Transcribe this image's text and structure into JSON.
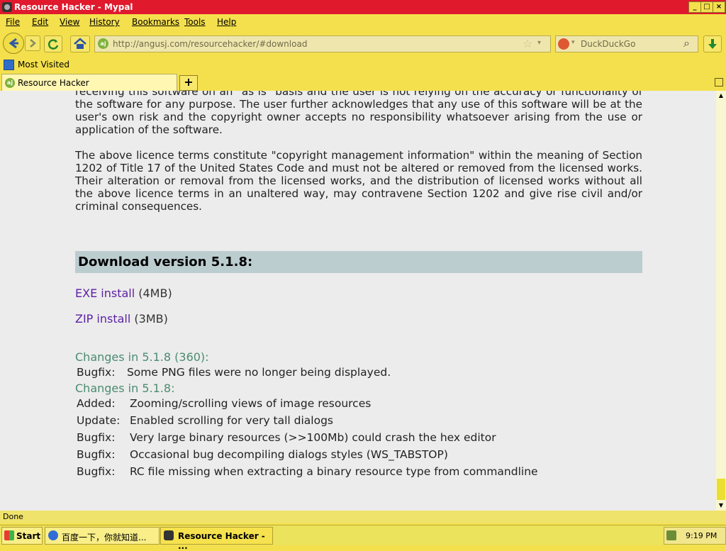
{
  "window": {
    "title": "Resource Hacker - Mypal"
  },
  "menu": [
    "File",
    "Edit",
    "View",
    "History",
    "Bookmarks",
    "Tools",
    "Help"
  ],
  "toolbar": {
    "url": "http://angusj.com/resourcehacker/#download",
    "search_placeholder": "DuckDuckGo"
  },
  "bookmarks": {
    "most_visited": "Most Visited"
  },
  "tab": {
    "label": "Resource Hacker"
  },
  "content": {
    "para1": "receiving this software on an \"as is\" basis and the user is not relying on the accuracy or functionality of the software for any purpose. The user further acknowledges that any use of this software will be at the user's own risk and the copyright owner accepts no responsibility whatsoever arising from the use or application of the software.",
    "para2": "The above licence terms constitute \"copyright management information\" within the meaning of Section 1202 of Title 17 of the United States Code and must not be altered or removed from the licensed works. Their alteration or removal from the licensed works, and the distribution of licensed works without all the above licence terms in an unaltered way, may contravene Section 1202 and give rise civil and/or criminal consequences.",
    "download_title": "Download version 5.1.8:",
    "downloads": [
      {
        "label": "EXE install",
        "size": "(4MB)"
      },
      {
        "label": "ZIP install",
        "size": "(3MB)"
      }
    ],
    "changes": [
      {
        "title": "Changes in 5.1.8 (360):",
        "items": [
          {
            "type": "Bugfix:",
            "text": "Some PNG files were no longer being displayed."
          }
        ]
      },
      {
        "title": "Changes in 5.1.8:",
        "items": [
          {
            "type": "Added:",
            "text": "Zooming/scrolling views of image resources"
          },
          {
            "type": "Update:",
            "text": "Enabled scrolling for very tall dialogs"
          },
          {
            "type": "Bugfix:",
            "text": "Very large binary resources (>>100Mb) could crash the hex editor"
          },
          {
            "type": "Bugfix:",
            "text": "Occasional bug decompiling dialogs styles (WS_TABSTOP)"
          },
          {
            "type": "Bugfix:",
            "text": "RC file missing when extracting a binary resource type from commandline"
          }
        ]
      }
    ]
  },
  "status": {
    "text": "Done"
  },
  "taskbar": {
    "start": "Start",
    "item1": "百度一下，你就知道...",
    "item2": "Resource Hacker - ...",
    "clock": "9:19 PM"
  },
  "colors": {
    "title": "#e0192d",
    "chrome": "#f4e04d",
    "link": "#5b1fa3",
    "changes": "#4b8b72",
    "header_bg": "#bccdd0"
  }
}
